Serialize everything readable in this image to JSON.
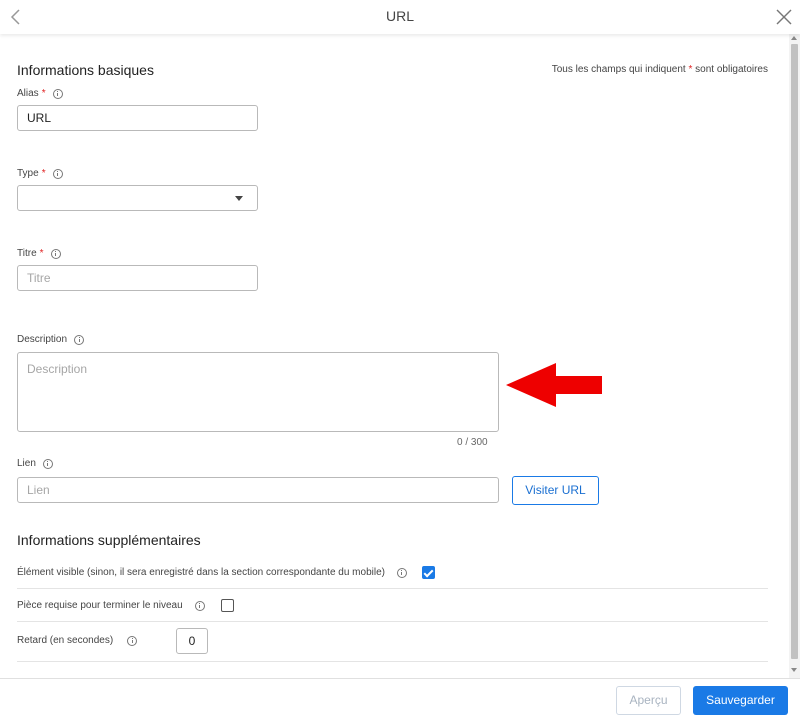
{
  "header": {
    "title": "URL"
  },
  "basic": {
    "section_title": "Informations basiques",
    "required_note_prefix": "Tous les champs qui indiquent",
    "required_note_star": "*",
    "required_note_suffix": "sont obligatoires"
  },
  "fields": {
    "alias": {
      "label": "Alias",
      "star": "*",
      "value": "URL"
    },
    "type": {
      "label": "Type",
      "star": "*",
      "value": ""
    },
    "titre": {
      "label": "Titre",
      "star": "*",
      "placeholder": "Titre"
    },
    "description": {
      "label": "Description",
      "placeholder": "Description",
      "counter": "0 / 300"
    },
    "lien": {
      "label": "Lien",
      "placeholder": "Lien",
      "button": "Visiter URL"
    }
  },
  "extra": {
    "section_title": "Informations supplémentaires",
    "visible_label": "Élément visible (sinon, il sera enregistré dans la section correspondante du mobile)",
    "visible_checked": true,
    "required_label": "Pièce requise pour terminer le niveau",
    "required_checked": false,
    "delay_label": "Retard (en secondes)",
    "delay_value": "0"
  },
  "footer": {
    "preview": "Aperçu",
    "save": "Sauvegarder"
  },
  "colors": {
    "accent": "#1a7ae6",
    "required_star": "#e02020",
    "annotation_arrow": "#ee0000"
  }
}
